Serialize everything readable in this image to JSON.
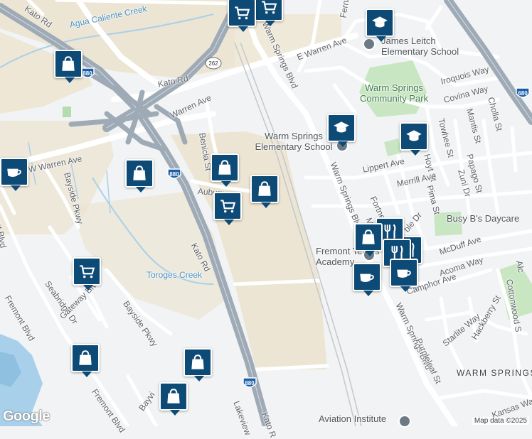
{
  "colors": {
    "background": "#f1f3f4",
    "industrial": "#ece5d3",
    "park": "#c9e6c2",
    "water": "#a9d0ea",
    "highway": "#9eaab6",
    "road": "#ffffff",
    "pin": "#0d4a75"
  },
  "streets": {
    "kato_rd_top": "Kato Rd",
    "agua_caliente": "Agua Caliente Creek",
    "kato_rd_mid": "Kato Rd",
    "e_warren": "E Warren Ave",
    "warm_springs_blvd_top": "Warm Springs Blvd",
    "fernald": "Fernald",
    "warren_ave": "Warren Ave",
    "w_warren": "W Warren Ave",
    "benicia": "Benicia St",
    "auburn": "Auburn",
    "bayside_pkwy_top": "Bayside Pkwy",
    "fremont_blvd_left": "Fremont Blvd",
    "kato_rd_lower": "Kato Rd",
    "toroges": "Toroges Creek",
    "seabridge": "Seabridge Dr",
    "gateway": "Gateway Blvd",
    "bayside_pkwy_mid": "Bayside Pkwy",
    "fremont_blvd_lower": "Fremont Blvd",
    "fremont_blvd_bottom": "Fremont Blvd",
    "bayvi": "Bayvi",
    "lakeview": "Lakeview",
    "kato_rd_bottom": "Kato R",
    "warm_springs_blvd_mid": "Warm Springs Blvd",
    "warm_springs_blvd_low": "Warm Springs Blvd",
    "iroquois": "Iroquois Way",
    "covina": "Covina Way",
    "cholla": "Cholla St",
    "mantis": "Mantis St",
    "towhee": "Towhee St",
    "hoyt": "Hoyt St",
    "papago": "Papago St",
    "zuni": "Zuni Dr",
    "lippert": "Lippert Ave",
    "merrill": "Merrill Ave",
    "pima": "Pima St",
    "fortner": "Fortner St",
    "mard": "Mard",
    "ble_dr": "ble Dr",
    "mcduff": "McDuff Ave",
    "acoma": "Acoma Way",
    "camphor": "Camphor Ave",
    "starlite": "Starlite Way",
    "hackberry": "Hackberry St",
    "cottonwood": "Cottonwood S",
    "purpleleaf": "Purpleleaf St",
    "kansas": "Kansas Way",
    "alc": "Alc"
  },
  "highways": {
    "i680": "680",
    "i880_a": "880",
    "i880_b": "880",
    "i880_c": "880",
    "r262": "262"
  },
  "places": {
    "james_leitch": "James Leitch Elementary School",
    "warm_springs_park": "Warm Springs Community Park",
    "warm_springs_elem": "Warm Springs Elementary School",
    "busy_bs": "Busy B's Daycare",
    "fremont_tennis": "Fremont Tennis Academy",
    "aviation": "Aviation Institute",
    "warm_springs_district": "WARM SPRINGS"
  },
  "markers": [
    {
      "type": "shopping-cart"
    },
    {
      "type": "shopping-bag"
    },
    {
      "type": "school"
    },
    {
      "type": "coffee-cup"
    },
    {
      "type": "shopping-bag"
    },
    {
      "type": "shopping-bag"
    },
    {
      "type": "shopping-bag"
    },
    {
      "type": "shopping-cart"
    },
    {
      "type": "school"
    },
    {
      "type": "school"
    },
    {
      "type": "shopping-cart"
    },
    {
      "type": "shopping-bag"
    },
    {
      "type": "restaurant"
    },
    {
      "type": "restaurant"
    },
    {
      "type": "coffee-cup"
    },
    {
      "type": "coffee-cup"
    },
    {
      "type": "shopping-bag"
    },
    {
      "type": "shopping-bag"
    },
    {
      "type": "shopping-bag"
    }
  ],
  "logo": "Google",
  "attribution": "Map data ©2025"
}
